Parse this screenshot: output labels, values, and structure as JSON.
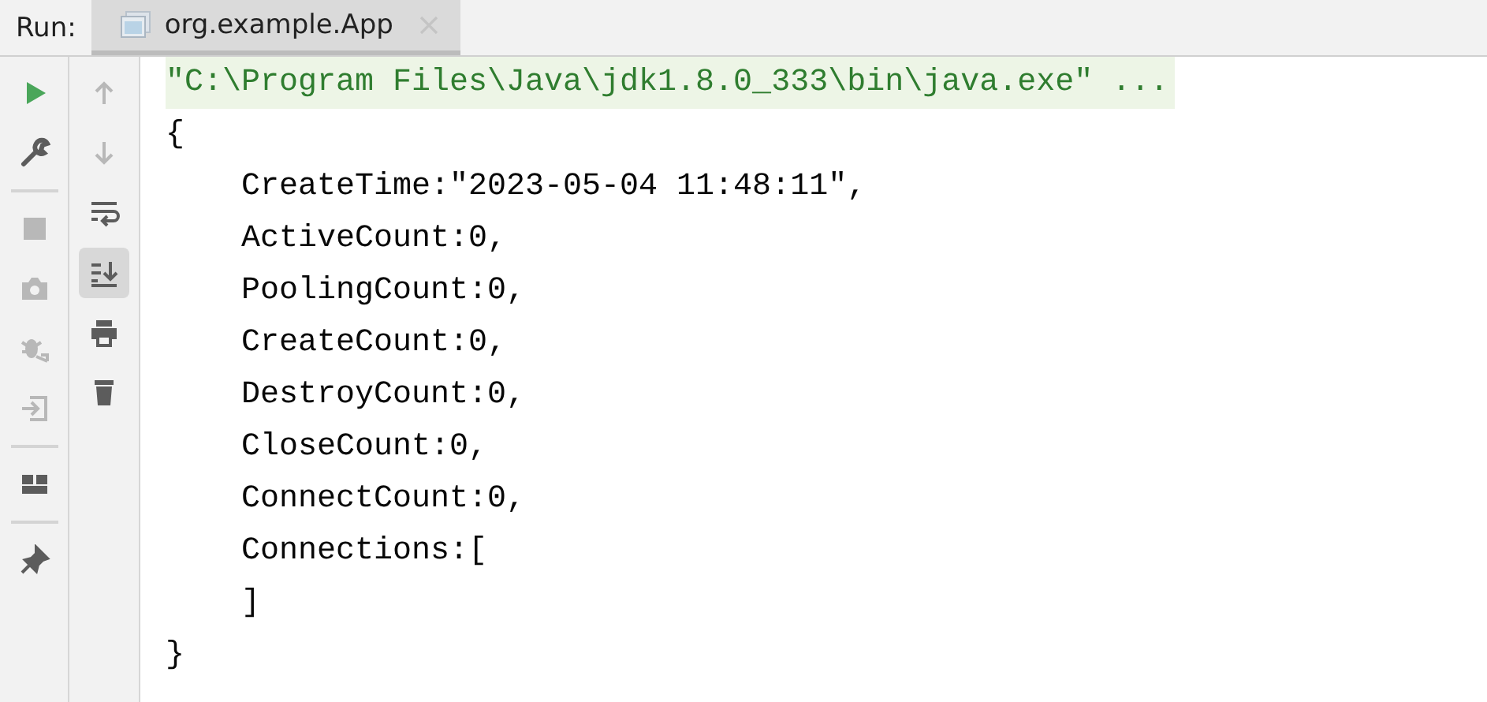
{
  "run_panel": {
    "label": "Run:",
    "tabs": [
      {
        "title": "org.example.App",
        "selected": true
      }
    ]
  },
  "left_toolbar": [
    {
      "kind": "button",
      "disabled": false
    },
    {
      "kind": "button",
      "disabled": false
    },
    {
      "kind": "separator"
    },
    {
      "kind": "button",
      "disabled": true
    },
    {
      "kind": "button",
      "disabled": true
    },
    {
      "kind": "button",
      "disabled": true
    },
    {
      "kind": "button",
      "disabled": true
    },
    {
      "kind": "separator"
    },
    {
      "kind": "button",
      "disabled": false
    },
    {
      "kind": "separator"
    },
    {
      "kind": "button",
      "disabled": false
    }
  ],
  "right_toolbar": [
    {
      "kind": "button",
      "disabled": true,
      "selected": false
    },
    {
      "kind": "button",
      "disabled": true,
      "selected": false
    },
    {
      "kind": "button",
      "disabled": false,
      "selected": false
    },
    {
      "kind": "button",
      "disabled": false,
      "selected": true
    },
    {
      "kind": "button",
      "disabled": false,
      "selected": false
    },
    {
      "kind": "button",
      "disabled": false,
      "selected": false
    }
  ],
  "console": [
    {
      "kind": "command",
      "text": "\"C:\\Program Files\\Java\\jdk1.8.0_333\\bin\\java.exe\" ..."
    },
    {
      "kind": "output",
      "text": "{"
    },
    {
      "kind": "output",
      "text": "    CreateTime:\"2023-05-04 11:48:11\","
    },
    {
      "kind": "output",
      "text": "    ActiveCount:0,"
    },
    {
      "kind": "output",
      "text": "    PoolingCount:0,"
    },
    {
      "kind": "output",
      "text": "    CreateCount:0,"
    },
    {
      "kind": "output",
      "text": "    DestroyCount:0,"
    },
    {
      "kind": "output",
      "text": "    CloseCount:0,"
    },
    {
      "kind": "output",
      "text": "    ConnectCount:0,"
    },
    {
      "kind": "output",
      "text": "    Connections:["
    },
    {
      "kind": "output",
      "text": "    ]"
    },
    {
      "kind": "output",
      "text": "}"
    }
  ]
}
